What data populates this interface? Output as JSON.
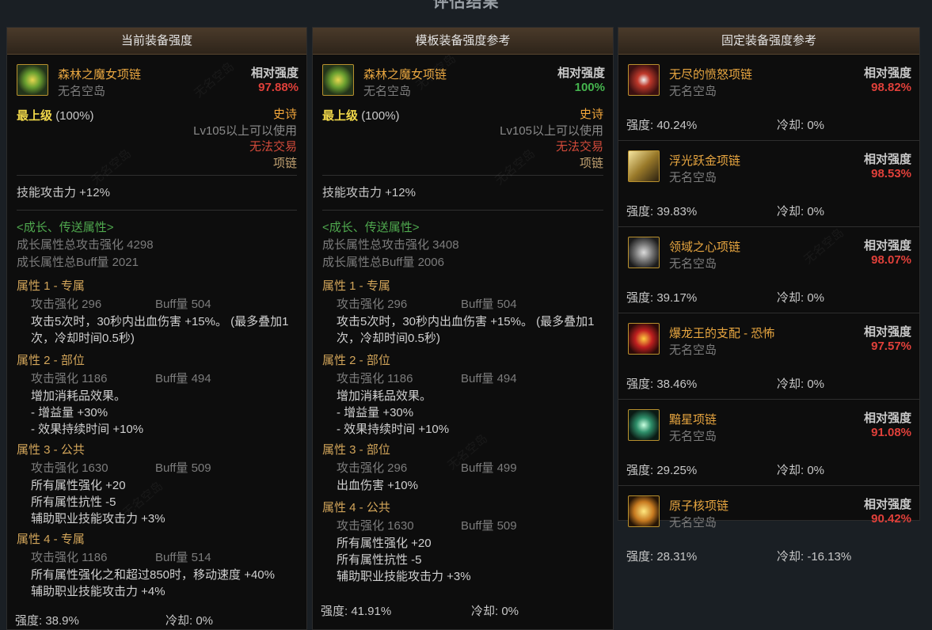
{
  "page": {
    "title": "评估结果"
  },
  "panels": {
    "current": {
      "header": "当前装备强度",
      "item": {
        "name": "森林之魔女项链",
        "owner": "无名空岛",
        "rel_label": "相对强度",
        "rel_value": "97.88%"
      },
      "grade": {
        "label": "最上级",
        "pct": "(100%)",
        "rarity": "史诗",
        "level_req": "Lv105以上可以使用",
        "trade": "无法交易",
        "slot": "项链"
      },
      "skill": "技能攻击力   +12%",
      "growth": {
        "title": "<成长、传送属性>",
        "atk_total": "成长属性总攻击强化 4298",
        "buff_total": "成长属性总Buff量 2021"
      },
      "attrs": [
        {
          "title": "属性 1 - 专属",
          "atk": "攻击强化   296",
          "buff": "Buff量   504",
          "lines": [
            "攻击5次时，30秒内出血伤害 +15%。 (最多叠加1次，冷却时间0.5秒)"
          ]
        },
        {
          "title": "属性 2 - 部位",
          "atk": "攻击强化   1186",
          "buff": "Buff量   494",
          "lines": [
            "增加消耗品效果。",
            "- 增益量 +30%",
            "- 效果持续时间 +10%"
          ]
        },
        {
          "title": "属性 3 - 公共",
          "atk": "攻击强化   1630",
          "buff": "Buff量   509",
          "lines": [
            "所有属性强化 +20",
            "所有属性抗性 -5",
            "辅助职业技能攻击力 +3%"
          ]
        },
        {
          "title": "属性 4 - 专属",
          "atk": "攻击强化   1186",
          "buff": "Buff量   514",
          "lines": [
            "所有属性强化之和超过850时，移动速度 +40%",
            "辅助职业技能攻击力 +4%"
          ]
        }
      ],
      "footer": {
        "strength": "强度: 38.9%",
        "cooldown": "冷却: 0%"
      }
    },
    "template": {
      "header": "模板装备强度参考",
      "item": {
        "name": "森林之魔女项链",
        "owner": "无名空岛",
        "rel_label": "相对强度",
        "rel_value": "100%"
      },
      "grade": {
        "label": "最上级",
        "pct": "(100%)",
        "rarity": "史诗",
        "level_req": "Lv105以上可以使用",
        "trade": "无法交易",
        "slot": "项链"
      },
      "skill": "技能攻击力   +12%",
      "growth": {
        "title": "<成长、传送属性>",
        "atk_total": "成长属性总攻击强化 3408",
        "buff_total": "成长属性总Buff量 2006"
      },
      "attrs": [
        {
          "title": "属性 1 - 专属",
          "atk": "攻击强化   296",
          "buff": "Buff量   504",
          "lines": [
            "攻击5次时，30秒内出血伤害 +15%。 (最多叠加1次，冷却时间0.5秒)"
          ]
        },
        {
          "title": "属性 2 - 部位",
          "atk": "攻击强化   1186",
          "buff": "Buff量   494",
          "lines": [
            "增加消耗品效果。",
            "- 增益量 +30%",
            "- 效果持续时间 +10%"
          ]
        },
        {
          "title": "属性 3 - 部位",
          "atk": "攻击强化   296",
          "buff": "Buff量   499",
          "lines": [
            "出血伤害 +10%"
          ]
        },
        {
          "title": "属性 4 - 公共",
          "atk": "攻击强化   1630",
          "buff": "Buff量   509",
          "lines": [
            "所有属性强化 +20",
            "所有属性抗性 -5",
            "辅助职业技能攻击力 +3%"
          ]
        }
      ],
      "footer": {
        "strength": "强度: 41.91%",
        "cooldown": "冷却: 0%"
      }
    },
    "fixed": {
      "header": "固定装备强度参考",
      "items": [
        {
          "name": "无尽的愤怒项链",
          "owner": "无名空岛",
          "rel_label": "相对强度",
          "rel_value": "98.82%",
          "strength": "强度: 40.24%",
          "cooldown": "冷却: 0%",
          "icon": "wrath-necklace-icon"
        },
        {
          "name": "浮光跃金项链",
          "owner": "无名空岛",
          "rel_label": "相对强度",
          "rel_value": "98.53%",
          "strength": "强度: 39.83%",
          "cooldown": "冷却: 0%",
          "icon": "gold-necklace-icon"
        },
        {
          "name": "领域之心项链",
          "owner": "无名空岛",
          "rel_label": "相对强度",
          "rel_value": "98.07%",
          "strength": "强度: 39.17%",
          "cooldown": "冷却: 0%",
          "icon": "domain-necklace-icon"
        },
        {
          "name": "爆龙王的支配 - 恐怖",
          "owner": "无名空岛",
          "rel_label": "相对强度",
          "rel_value": "97.57%",
          "strength": "强度: 38.46%",
          "cooldown": "冷却: 0%",
          "icon": "dragon-necklace-icon"
        },
        {
          "name": "黯星项链",
          "owner": "无名空岛",
          "rel_label": "相对强度",
          "rel_value": "91.08%",
          "strength": "强度: 29.25%",
          "cooldown": "冷却: 0%",
          "icon": "dark-star-necklace-icon"
        },
        {
          "name": "原子核项链",
          "owner": "无名空岛",
          "rel_label": "相对强度",
          "rel_value": "90.42%",
          "strength": "强度: 28.31%",
          "cooldown": "冷却: -16.13%",
          "icon": "atom-necklace-icon"
        }
      ]
    }
  },
  "watermark": "无名空岛",
  "colors": {
    "accent_orange": "#e8a640",
    "red": "#e0403a",
    "green": "#45b54e",
    "growth_green": "#4fa94e",
    "gold": "#f1d84a"
  }
}
